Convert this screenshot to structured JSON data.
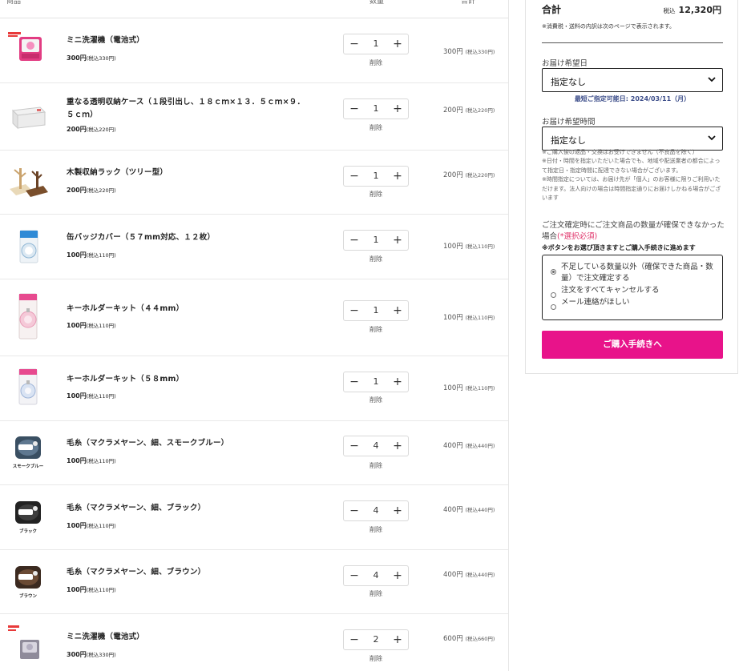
{
  "table_header": {
    "product": "商品",
    "quantity": "数量",
    "total": "合計"
  },
  "items": [
    {
      "name": "ミニ洗濯機（電池式）",
      "price": "300円",
      "price_tax": "(税込330円)",
      "qty": "1",
      "delete": "削除",
      "line_total": "300円",
      "line_total_tax": "(税込330円)",
      "thumb": "mini-washer-pink"
    },
    {
      "name": "重なる透明収納ケース（１段引出し、１８ｃｍ×１３．５ｃｍ×９．５ｃｍ）",
      "price": "200円",
      "price_tax": "(税込220円)",
      "qty": "1",
      "delete": "削除",
      "line_total": "200円",
      "line_total_tax": "(税込220円)",
      "thumb": "clear-storage-case"
    },
    {
      "name": "木製収納ラック（ツリー型）",
      "price": "200円",
      "price_tax": "(税込220円)",
      "qty": "1",
      "delete": "削除",
      "line_total": "200円",
      "line_total_tax": "(税込220円)",
      "thumb": "wooden-tree-rack"
    },
    {
      "name": "缶バッジカバー（５７mm対応、１２枚）",
      "price": "100円",
      "price_tax": "(税込110円)",
      "qty": "1",
      "delete": "削除",
      "line_total": "100円",
      "line_total_tax": "(税込110円)",
      "thumb": "badge-cover-pack"
    },
    {
      "name": "キーホルダーキット（４４mm）",
      "price": "100円",
      "price_tax": "(税込110円)",
      "qty": "1",
      "delete": "削除",
      "line_total": "100円",
      "line_total_tax": "(税込110円)",
      "thumb": "keyholder-kit-44"
    },
    {
      "name": "キーホルダーキット（５８mm）",
      "price": "100円",
      "price_tax": "(税込110円)",
      "qty": "1",
      "delete": "削除",
      "line_total": "100円",
      "line_total_tax": "(税込110円)",
      "thumb": "keyholder-kit-58"
    },
    {
      "name": "毛糸（マクラメヤーン、細、スモークブルー）",
      "price": "100円",
      "price_tax": "(税込110円)",
      "qty": "4",
      "delete": "削除",
      "line_total": "400円",
      "line_total_tax": "(税込440円)",
      "thumb": "yarn-smoke-blue",
      "thumb_caption": "スモークブルー"
    },
    {
      "name": "毛糸（マクラメヤーン、細、ブラック）",
      "price": "100円",
      "price_tax": "(税込110円)",
      "qty": "4",
      "delete": "削除",
      "line_total": "400円",
      "line_total_tax": "(税込440円)",
      "thumb": "yarn-black",
      "thumb_caption": "ブラック"
    },
    {
      "name": "毛糸（マクラメヤーン、細、ブラウン）",
      "price": "100円",
      "price_tax": "(税込110円)",
      "qty": "4",
      "delete": "削除",
      "line_total": "400円",
      "line_total_tax": "(税込440円)",
      "thumb": "yarn-brown",
      "thumb_caption": "ブラウン"
    },
    {
      "name": "ミニ洗濯機（電池式）",
      "price": "300円",
      "price_tax": "(税込330円)",
      "qty": "2",
      "delete": "削除",
      "line_total": "600円",
      "line_total_tax": "(税込660円)",
      "thumb": "mini-washer-grey"
    }
  ],
  "qty_controls": {
    "minus": "−",
    "plus": "+"
  },
  "summary": {
    "total_label": "合計",
    "total_tax_prefix": "税込",
    "total_value": "12,320円",
    "note": "※消費税・送料の内訳は次のページで表示されます。",
    "delivery_date_label": "お届け希望日",
    "delivery_date_value": "指定なし",
    "earliest_date": "最短ご指定可能日: 2024/03/11（月）",
    "delivery_time_label": "お届け希望時間",
    "delivery_time_value": "指定なし",
    "notes": [
      "※ご購入後の返品・交換はお受けできません（不良品を除く）",
      "※日付・時間を指定いただいた場合でも、地域や配送業者の都合によって指定日・指定時間に配達できない場合がございます。",
      "※時間指定については、お届け先が「個人」のお客様に限りご利用いただけます。法人向けの場合は時間指定通りにお届けしかねる場合がございます"
    ],
    "shortage_question": "ご注文確定時にご注文商品の数量が確保できなかった場合",
    "required": "(*選択必須)",
    "shortage_hint": "※ボタンをお選び頂きますとご購入手続きに進めます",
    "options": [
      "不足している数量以外（確保できた商品・数量）で注文確定する",
      "注文をすべてキャンセルする",
      "メール連絡がほしい"
    ],
    "checkout_label": "ご購入手続きへ"
  },
  "colors": {
    "accent": "#e8138a",
    "date_note": "#3d4e8a",
    "required": "#e0336a"
  }
}
